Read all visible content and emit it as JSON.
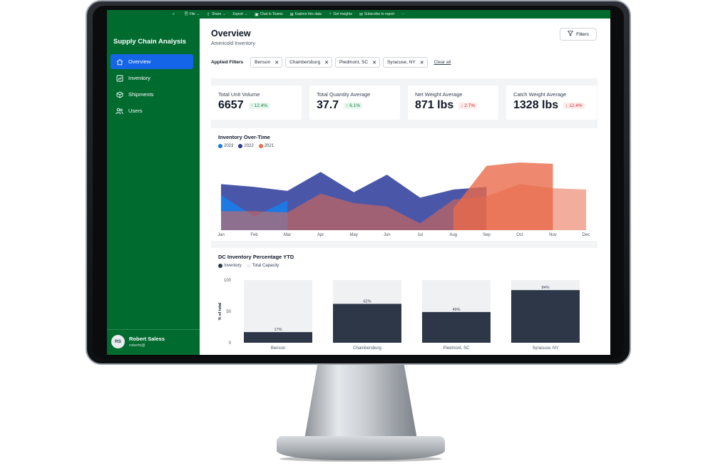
{
  "toolbar": {
    "collapse": "«",
    "items": [
      {
        "label": "File",
        "glyph": "🗎",
        "dropdown": "⌄"
      },
      {
        "label": "Share",
        "glyph": "⇪",
        "dropdown": "⌄"
      },
      {
        "label": "Export",
        "glyph": "",
        "dropdown": "⌄"
      },
      {
        "label": "Chat in Teams",
        "glyph": "▣",
        "dropdown": ""
      },
      {
        "label": "Explore this data",
        "glyph": "⊞",
        "dropdown": ""
      },
      {
        "label": "Get insights",
        "glyph": "♀",
        "dropdown": ""
      },
      {
        "label": "Subscribe to report",
        "glyph": "✉",
        "dropdown": ""
      },
      {
        "label": "···",
        "glyph": "",
        "dropdown": ""
      }
    ]
  },
  "sidebar": {
    "title": "Supply Chain Analysis",
    "items": [
      {
        "label": "Overview",
        "icon": "home-icon",
        "active": true
      },
      {
        "label": "Inventory",
        "icon": "chart-icon",
        "active": false
      },
      {
        "label": "Shipments",
        "icon": "box-icon",
        "active": false
      },
      {
        "label": "Users",
        "icon": "users-icon",
        "active": false
      }
    ],
    "user": {
      "initials": "RS",
      "name": "Robert Saless",
      "email": "roberts@"
    }
  },
  "header": {
    "title": "Overview",
    "subtitle": "Americold Inventory",
    "filters_button": "Filters"
  },
  "applied_filters": {
    "label": "Applied Filters",
    "chips": [
      "Benson",
      "Chambersburg",
      "Piedmont, SC",
      "Syracuse, NY"
    ],
    "clear_label": "Clear all"
  },
  "kpis": [
    {
      "label": "Total Unit Volume",
      "value": "6657",
      "delta": "↑ 12.4%",
      "trend": "up"
    },
    {
      "label": "Total Quantity Average",
      "value": "37.7",
      "delta": "↑ 6.1%",
      "trend": "up"
    },
    {
      "label": "Net Weight Average",
      "value": "871 lbs",
      "delta": "↓ 2.7%",
      "trend": "down"
    },
    {
      "label": "Catch Weight Average",
      "value": "1328 lbs",
      "delta": "↓ 12.4%",
      "trend": "down"
    }
  ],
  "colors": {
    "brand_green": "#006b2f",
    "active_blue": "#1565e8",
    "series_2023": "#1a7be6",
    "series_2022": "#2a3a9a",
    "series_2021": "#ea6a4a",
    "inventory_bar": "#2d3748",
    "capacity_bar": "#f0f1f3"
  },
  "chart_data": [
    {
      "type": "area",
      "title": "Inventory Over-Time",
      "categories": [
        "Jan",
        "Feb",
        "Mar",
        "Apr",
        "May",
        "Jun",
        "Jul",
        "Aug",
        "Sep",
        "Oct",
        "Nov",
        "Dec"
      ],
      "ylim": [
        0,
        100
      ],
      "grid": false,
      "legend": "top-left",
      "series": [
        {
          "name": "2021",
          "color": "#ea6a4a",
          "values": [
            null,
            null,
            null,
            null,
            null,
            null,
            null,
            32,
            95,
            100,
            98,
            null
          ]
        },
        {
          "name": "2022",
          "color": "#2a3a9a",
          "values": [
            68,
            64,
            58,
            86,
            56,
            82,
            48,
            60,
            64,
            null,
            null,
            null
          ]
        },
        {
          "name": "2023",
          "color": "#1a7be6",
          "values": [
            52,
            20,
            44,
            null,
            null,
            null,
            null,
            null,
            null,
            null,
            null,
            null
          ]
        },
        {
          "name": "2021-blend",
          "color": "#ea6a4a",
          "values": [
            28,
            28,
            26,
            54,
            40,
            35,
            10,
            45,
            50,
            68,
            62,
            60
          ]
        }
      ]
    },
    {
      "type": "bar",
      "title": "DC Inventory Percentage YTD",
      "ylabel": "% of total",
      "ylim": [
        0,
        100
      ],
      "yticks": [
        0,
        50,
        100
      ],
      "legend": "top-left",
      "categories": [
        "Benson",
        "Chambersburg",
        "Piedmont, SC",
        "Syracuse, NY"
      ],
      "series": [
        {
          "name": "Inventory",
          "values": [
            17,
            62,
            49,
            84
          ],
          "labels": [
            "17%",
            "62%",
            "49%",
            "84%"
          ]
        },
        {
          "name": "Total Capacity",
          "values": [
            100,
            100,
            100,
            100
          ]
        }
      ]
    }
  ]
}
